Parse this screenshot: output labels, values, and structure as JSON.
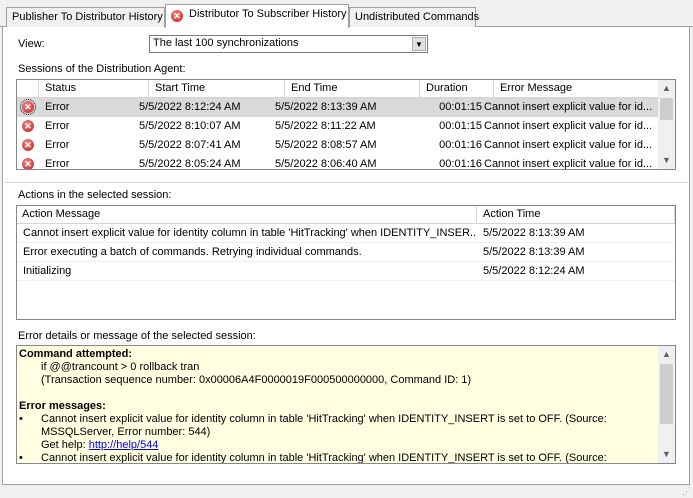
{
  "tabs": [
    {
      "label": "Publisher To Distributor History",
      "active": false
    },
    {
      "label": "Distributor To Subscriber History",
      "active": true,
      "icon": "error-icon"
    },
    {
      "label": "Undistributed Commands",
      "active": false
    }
  ],
  "view": {
    "label": "View:",
    "selected": "The last 100 synchronizations"
  },
  "sessions": {
    "label": "Sessions of the Distribution Agent:",
    "columns": [
      "Status",
      "Start Time",
      "End Time",
      "Duration",
      "Error Message"
    ],
    "rows": [
      {
        "status": "Error",
        "start": "5/5/2022 8:12:24 AM",
        "end": "5/5/2022 8:13:39 AM",
        "duration": "00:01:15",
        "error": "Cannot insert explicit value for id..."
      },
      {
        "status": "Error",
        "start": "5/5/2022 8:10:07 AM",
        "end": "5/5/2022 8:11:22 AM",
        "duration": "00:01:15",
        "error": "Cannot insert explicit value for id..."
      },
      {
        "status": "Error",
        "start": "5/5/2022 8:07:41 AM",
        "end": "5/5/2022 8:08:57 AM",
        "duration": "00:01:16",
        "error": "Cannot insert explicit value for id..."
      },
      {
        "status": "Error",
        "start": "5/5/2022 8:05:24 AM",
        "end": "5/5/2022 8:06:40 AM",
        "duration": "00:01:16",
        "error": "Cannot insert explicit value for id..."
      }
    ]
  },
  "actions": {
    "label": "Actions in the selected session:",
    "columns": [
      "Action Message",
      "Action Time"
    ],
    "rows": [
      {
        "message": "Cannot insert explicit value for identity column in table 'HitTracking' when IDENTITY_INSER...",
        "time": "5/5/2022 8:13:39 AM"
      },
      {
        "message": "Error executing a batch of commands. Retrying individual commands.",
        "time": "5/5/2022 8:13:39 AM"
      },
      {
        "message": "Initializing",
        "time": "5/5/2022 8:12:24 AM"
      }
    ]
  },
  "details": {
    "label": "Error details or message of the selected session:",
    "command_heading": "Command attempted:",
    "command_line1": "if @@trancount > 0 rollback tran",
    "command_line2": "(Transaction sequence number: 0x00006A4F0000019F000500000000, Command ID: 1)",
    "messages_heading": "Error messages:",
    "bullet": "•",
    "msg1": "Cannot insert explicit value for identity column in table 'HitTracking' when IDENTITY_INSERT is set to OFF. (Source: MSSQLServer, Error number: 544)",
    "help_label": "Get help:",
    "help_link": "http://help/544",
    "msg2": "Cannot insert explicit value for identity column in table 'HitTracking' when IDENTITY_INSERT is set to OFF. (Source:"
  }
}
